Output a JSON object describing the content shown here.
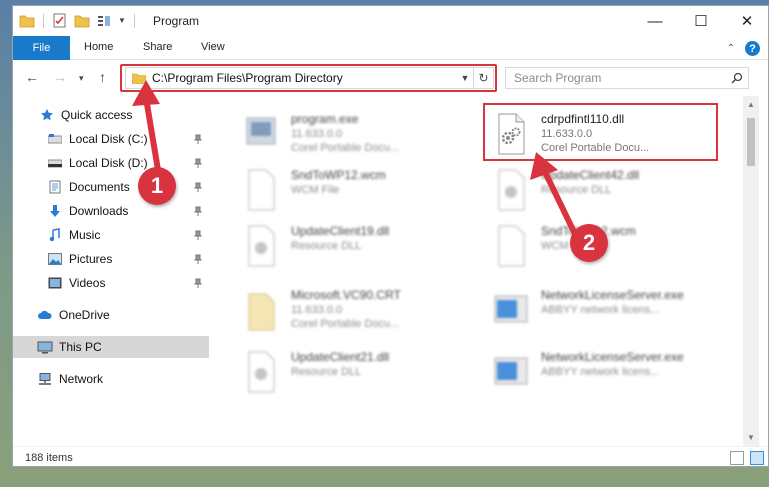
{
  "window": {
    "title": "Program",
    "controls": {
      "minimize": "—",
      "maximize": "☐",
      "close": "✕"
    }
  },
  "ribbon": {
    "tabs": [
      "File",
      "Home",
      "Share",
      "View"
    ],
    "chevron": "⌃",
    "help": "?"
  },
  "nav": {
    "address": "C:\\Program Files\\Program Directory",
    "search_placeholder": "Search Program"
  },
  "sidebar": {
    "items": [
      {
        "label": "Quick access",
        "icon": "star-icon",
        "pinned": false
      },
      {
        "label": "Local Disk (C:)",
        "icon": "drive-icon",
        "pinned": true
      },
      {
        "label": "Local Disk (D:)",
        "icon": "drive-icon",
        "pinned": true
      },
      {
        "label": "Documents",
        "icon": "documents-icon",
        "pinned": true
      },
      {
        "label": "Downloads",
        "icon": "download-icon",
        "pinned": true
      },
      {
        "label": "Music",
        "icon": "music-icon",
        "pinned": true
      },
      {
        "label": "Pictures",
        "icon": "pictures-icon",
        "pinned": true
      },
      {
        "label": "Videos",
        "icon": "video-icon",
        "pinned": true
      },
      {
        "label": "OneDrive",
        "icon": "cloud-icon",
        "pinned": false
      },
      {
        "label": "This PC",
        "icon": "computer-icon",
        "pinned": false,
        "selected": true
      },
      {
        "label": "Network",
        "icon": "network-icon",
        "pinned": false
      }
    ]
  },
  "files": {
    "highlighted": {
      "name": "cdrpdfintl110.dll",
      "version": "11.633.0.0",
      "desc": "Corel Portable Docu..."
    },
    "items": [
      {
        "name": "program.exe",
        "line2": "11.633.0.0",
        "line3": "Corel Portable Docu..."
      },
      {
        "name": "SndToWP12.wcm",
        "line2": "WCM File"
      },
      {
        "name": "UpdateClient42.dll",
        "line2": "Resource DLL"
      },
      {
        "name": "UpdateClient19.dll",
        "line2": "Resource DLL"
      },
      {
        "name": "SndToWP12.wcm",
        "line2": "WCM File"
      },
      {
        "name": "Microsoft.VC90.CRT",
        "line2": "11.633.0.0",
        "line3": "Corel Portable Docu..."
      },
      {
        "name": "NetworkLicenseServer.exe",
        "line2": "ABBYY network licens..."
      },
      {
        "name": "UpdateClient21.dll",
        "line2": "Resource DLL"
      },
      {
        "name": "NetworkLicenseServer.exe",
        "line2": "ABBYY network licens..."
      }
    ]
  },
  "status": {
    "count": "188 items"
  },
  "callouts": {
    "one": "1",
    "two": "2"
  },
  "colors": {
    "accent": "#1979ca",
    "highlight": "#d9333f",
    "selected": "#d7d7d7"
  }
}
